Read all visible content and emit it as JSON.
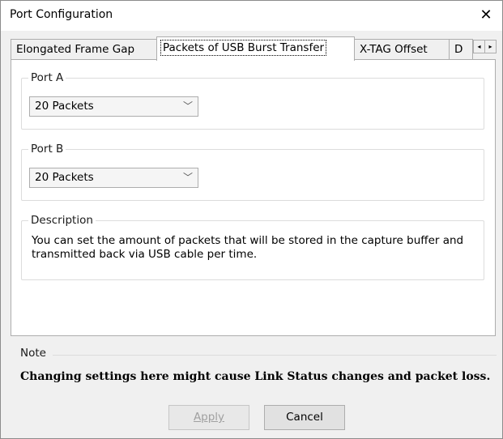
{
  "window": {
    "title": "Port Configuration",
    "close_glyph": "✕"
  },
  "tabs": [
    {
      "label": "Elongated Frame Gap",
      "active": false
    },
    {
      "label": "Packets of USB Burst Transfer",
      "active": true
    },
    {
      "label": "X-TAG Offset",
      "active": false
    },
    {
      "label": "D",
      "active": false
    }
  ],
  "tab_scroll": {
    "left_glyph": "◂",
    "right_glyph": "▸"
  },
  "port_a": {
    "title": "Port A",
    "selected": "20 Packets"
  },
  "port_b": {
    "title": "Port B",
    "selected": "20 Packets"
  },
  "description": {
    "title": "Description",
    "text": "You can set the amount of packets that will be stored in the capture buffer and transmitted back via USB cable per time."
  },
  "note": {
    "title": "Note",
    "text": "Changing settings here might cause Link Status changes and packet loss."
  },
  "buttons": {
    "apply_label": "Apply",
    "cancel_label": "Cancel"
  },
  "icons": {
    "close": "close-icon",
    "combo_arrow": "chevron-down-icon"
  }
}
